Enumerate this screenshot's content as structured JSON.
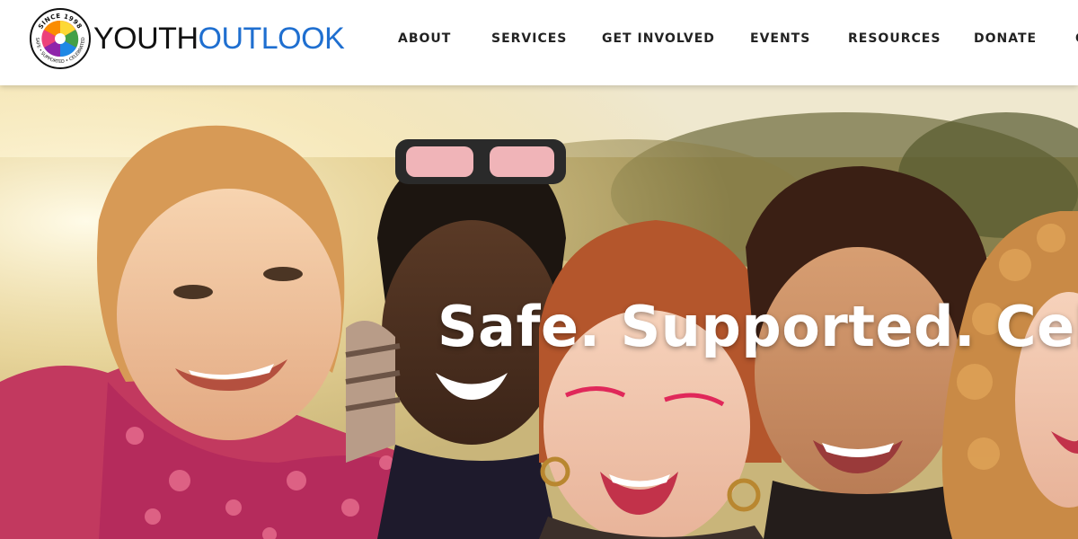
{
  "logo": {
    "badge_top": "SINCE 1998",
    "badge_bottom": "SAFE • SUPPORTED • CELEBRATED",
    "word_part1": "YOUTH",
    "word_part2": "OUTLOOK",
    "color_dark": "#111111",
    "color_accent": "#1f6fd0"
  },
  "nav": {
    "items": [
      "ABOUT",
      "SERVICES",
      "GET INVOLVED",
      "EVENTS",
      "RESOURCES",
      "DONATE"
    ],
    "overflow_glyph": "C"
  },
  "hero": {
    "headline": "Safe. Supported. Celebrated."
  }
}
